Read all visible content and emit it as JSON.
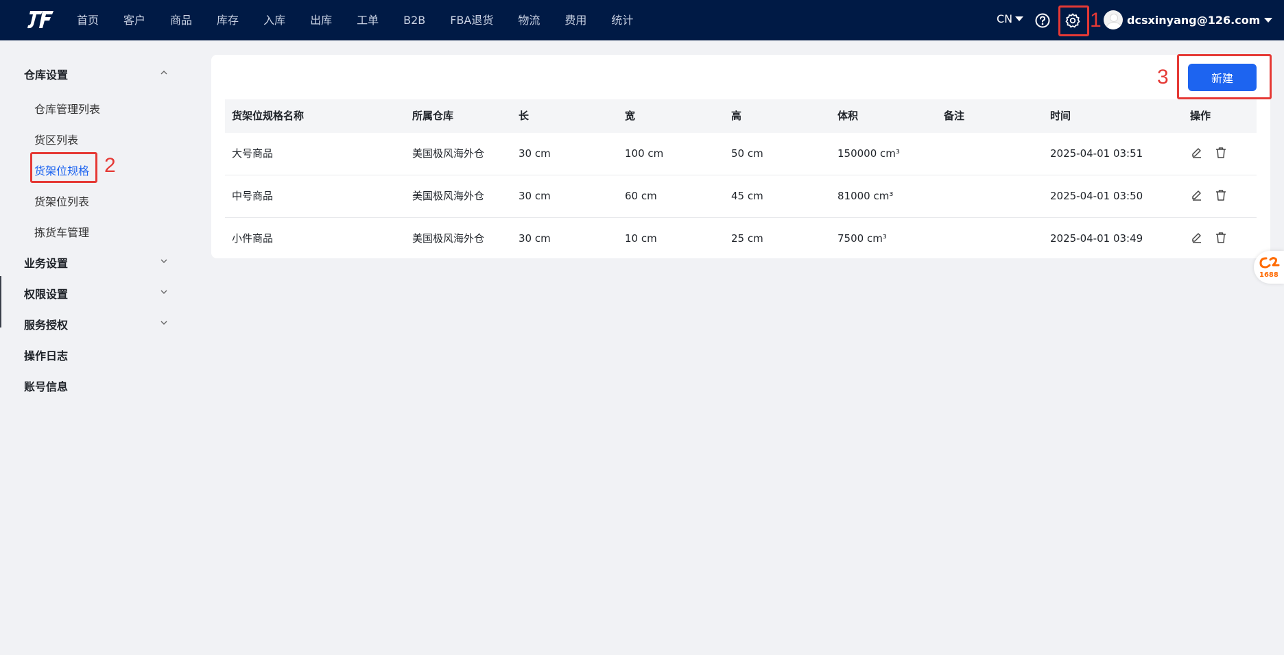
{
  "nav": {
    "items": [
      "首页",
      "客户",
      "商品",
      "库存",
      "入库",
      "出库",
      "工单",
      "B2B",
      "FBA退货",
      "物流",
      "费用",
      "统计"
    ],
    "lang": "CN",
    "user": "dcsxinyang@126.com"
  },
  "annotations": [
    "1",
    "2",
    "3"
  ],
  "sidebar": {
    "groups": {
      "warehouse": "仓库设置",
      "business": "业务设置",
      "permission": "权限设置",
      "service": "服务授权",
      "oplog": "操作日志",
      "account": "账号信息"
    },
    "items": [
      "仓库管理列表",
      "货区列表",
      "货架位规格",
      "货架位列表",
      "拣货车管理"
    ]
  },
  "main": {
    "new_button": "新建",
    "columns": [
      "货架位规格名称",
      "所属仓库",
      "长",
      "宽",
      "高",
      "体积",
      "备注",
      "时间",
      "操作"
    ],
    "rows": [
      {
        "name": "大号商品",
        "warehouse": "美国极风海外仓",
        "length": "30 cm",
        "width": "100 cm",
        "height": "50 cm",
        "volume": "150000 cm³",
        "note": "",
        "time": "2025-04-01 03:51"
      },
      {
        "name": "中号商品",
        "warehouse": "美国极风海外仓",
        "length": "30 cm",
        "width": "60 cm",
        "height": "45 cm",
        "volume": "81000 cm³",
        "note": "",
        "time": "2025-04-01 03:50"
      },
      {
        "name": "小件商品",
        "warehouse": "美国极风海外仓",
        "length": "30 cm",
        "width": "10 cm",
        "height": "25 cm",
        "volume": "7500 cm³",
        "note": "",
        "time": "2025-04-01 03:49"
      }
    ]
  },
  "badge": "1688",
  "colors": {
    "nav_bg": "#001a45",
    "primary": "#1d64f0",
    "annotation": "#e53935"
  }
}
